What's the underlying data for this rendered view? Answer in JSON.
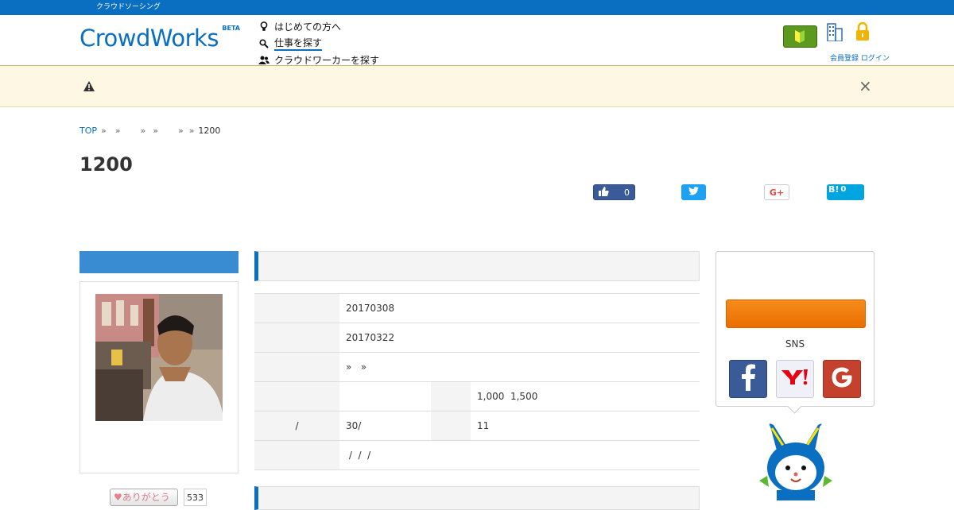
{
  "topbar": {
    "text": "クラウドソーシング"
  },
  "header": {
    "logo": "CrowdWorks",
    "logo_badge": "BETA",
    "nav": [
      {
        "label": "はじめての方へ",
        "icon": "lightbulb-icon"
      },
      {
        "label": "仕事を探す",
        "icon": "search-icon"
      },
      {
        "label": "クラウドワーカーを探す",
        "icon": "users-icon"
      }
    ],
    "links": "会員登録 ログイン"
  },
  "breadcrumb": {
    "top": "TOP",
    "separator": "»",
    "current": "1200"
  },
  "page": {
    "title": "1200"
  },
  "share": {
    "fb_like_count": "0",
    "google_plus": "G+",
    "hatena_label": "B!",
    "hatena_count": "0"
  },
  "job_info": {
    "rows": [
      {
        "label": "",
        "value": "20170308"
      },
      {
        "label": "",
        "value": "20170322"
      },
      {
        "label": "",
        "value": "»   »"
      },
      {
        "label": "",
        "value": "",
        "label2": "",
        "value2": "1,000  1,500"
      },
      {
        "label": "/",
        "value": "30/",
        "label2": "",
        "value2": "11"
      },
      {
        "label": "",
        "value": " /  /  /"
      }
    ]
  },
  "sidebar": {
    "sns_label": "SNS",
    "thanks_label": "ありがとう",
    "thanks_count": "533"
  },
  "colors": {
    "brand_blue": "#0a6fc1",
    "cta_orange": "#f07d0e",
    "alert_bg": "#fdf7e3"
  }
}
